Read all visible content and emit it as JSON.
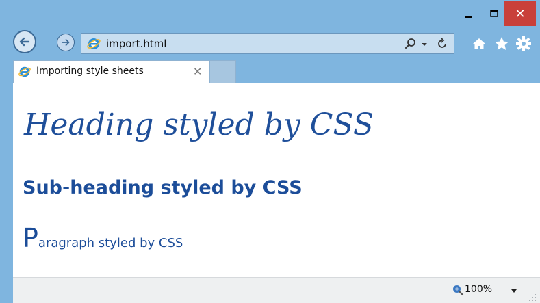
{
  "window": {
    "minimize_label": "–",
    "maximize_label": "□",
    "close_label": "✕"
  },
  "address_bar": {
    "url": "import.html"
  },
  "tab": {
    "title": "Importing style sheets",
    "close_label": "✕"
  },
  "page": {
    "heading": "Heading styled by CSS",
    "subheading": "Sub-heading styled by CSS",
    "paragraph_first_letter": "P",
    "paragraph_rest": "aragraph styled by CSS"
  },
  "status_bar": {
    "zoom": "100%"
  },
  "icons": {
    "back": "back-arrow-icon",
    "forward": "forward-arrow-icon",
    "site": "ie-icon",
    "search": "search-icon",
    "refresh": "refresh-icon",
    "home": "home-icon",
    "favorites": "star-icon",
    "tools": "gear-icon",
    "zoom": "zoom-icon"
  },
  "colors": {
    "frame": "#7fb5df",
    "close_button": "#c9403a",
    "heading_text": "#1f4f9a",
    "status_bar": "#eef0f1"
  }
}
